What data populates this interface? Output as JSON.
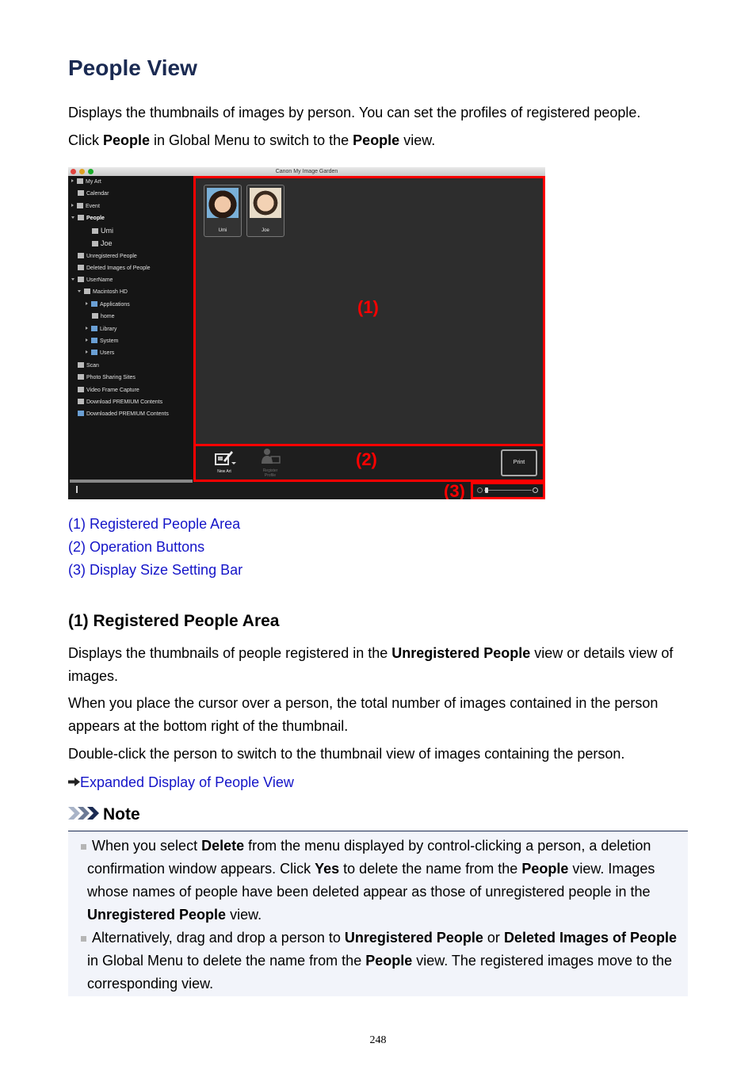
{
  "title": "People View",
  "intro": {
    "line1": "Displays the thumbnails of images by person. You can set the profiles of registered people.",
    "line2_pre": "Click ",
    "line2_b1": "People",
    "line2_mid": " in Global Menu to switch to the ",
    "line2_b2": "People",
    "line2_post": " view."
  },
  "window": {
    "title": "Canon My Image Garden",
    "traffic_lights": [
      "#e0443e",
      "#dea123",
      "#1aab29"
    ],
    "sidebar": [
      {
        "label": "My Art",
        "icon": "my-art-icon",
        "arrow": "closed"
      },
      {
        "label": "Calendar",
        "icon": "calendar-icon",
        "arrow": "none"
      },
      {
        "label": "Event",
        "icon": "event-icon",
        "arrow": "closed"
      },
      {
        "label": "People",
        "icon": "people-icon",
        "arrow": "open"
      },
      {
        "label": "Umi",
        "icon": "person-photo-icon",
        "arrow": "none"
      },
      {
        "label": "Joe",
        "icon": "person-photo-icon",
        "arrow": "none"
      },
      {
        "label": "Unregistered People",
        "icon": "unregistered-people-icon",
        "arrow": "none"
      },
      {
        "label": "Deleted Images of People",
        "icon": "deleted-people-icon",
        "arrow": "none"
      },
      {
        "label": "UserName",
        "icon": "computer-icon",
        "arrow": "open"
      },
      {
        "label": "Macintosh HD",
        "icon": "disk-icon",
        "arrow": "open"
      },
      {
        "label": "Applications",
        "icon": "folder-icon",
        "arrow": "closed"
      },
      {
        "label": "home",
        "icon": "home-icon",
        "arrow": "none"
      },
      {
        "label": "Library",
        "icon": "folder-icon",
        "arrow": "closed"
      },
      {
        "label": "System",
        "icon": "folder-icon",
        "arrow": "closed"
      },
      {
        "label": "Users",
        "icon": "folder-icon",
        "arrow": "closed"
      },
      {
        "label": "Scan",
        "icon": "scan-icon",
        "arrow": "none"
      },
      {
        "label": "Photo Sharing Sites",
        "icon": "photo-sharing-icon",
        "arrow": "none"
      },
      {
        "label": "Video Frame Capture",
        "icon": "video-frame-icon",
        "arrow": "none"
      },
      {
        "label": "Download PREMIUM Contents",
        "icon": "download-icon",
        "arrow": "none"
      },
      {
        "label": "Downloaded PREMIUM Contents",
        "icon": "folder-icon",
        "arrow": "none"
      }
    ],
    "people": [
      {
        "name": "Umi"
      },
      {
        "name": "Joe"
      }
    ],
    "buttons": {
      "new_art": "New Art",
      "register_profile": "Register Profile",
      "print": "Print"
    },
    "callouts": {
      "one": "(1)",
      "two": "(2)",
      "three": "(3)"
    },
    "highlight_color": "#ff0000"
  },
  "links": [
    "(1) Registered People Area",
    "(2) Operation Buttons",
    "(3) Display Size Setting Bar"
  ],
  "section1": {
    "heading": "(1) Registered People Area",
    "p1_pre": "Displays the thumbnails of people registered in the ",
    "p1_b": "Unregistered People",
    "p1_post": " view or details view of images.",
    "p2": "When you place the cursor over a person, the total number of images contained in the person appears at the bottom right of the thumbnail.",
    "p3": "Double-click the person to switch to the thumbnail view of images containing the person.",
    "related_link": "Expanded Display of People View"
  },
  "note": {
    "heading": "Note",
    "item1": {
      "t1": "When you select ",
      "b1": "Delete",
      "t2": " from the menu displayed by control-clicking a person, a deletion confirmation window appears. Click ",
      "b2": "Yes",
      "t3": " to delete the name from the ",
      "b3": "People",
      "t4": " view. Images whose names of people have been deleted appear as those of unregistered people in the ",
      "b4": "Unregistered People",
      "t5": " view."
    },
    "item2": {
      "t1": "Alternatively, drag and drop a person to ",
      "b1": "Unregistered People",
      "t2": " or ",
      "b2": "Deleted Images of People",
      "t3": " in Global Menu to delete the name from the ",
      "b3": "People",
      "t4": " view. The registered images move to the corresponding view."
    }
  },
  "page_number": "248"
}
